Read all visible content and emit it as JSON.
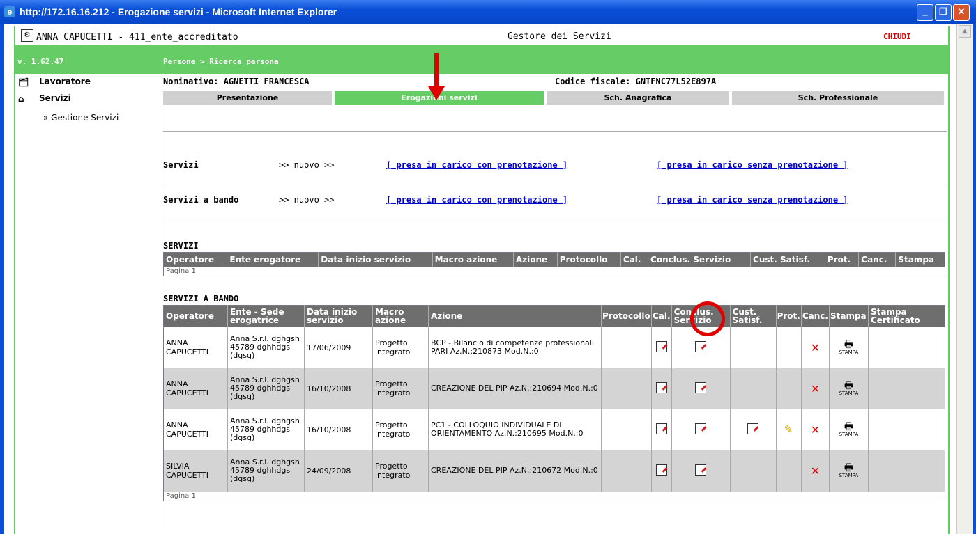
{
  "window": {
    "title": "http://172.16.16.212 - Erogazione servizi - Microsoft Internet Explorer",
    "buttons": {
      "minimize": "_",
      "maximize": "❐",
      "close": "✕"
    }
  },
  "header": {
    "user": "ANNA CAPUCETTI - 411_ente_accreditato",
    "app_title": "Gestore dei Servizi",
    "close_label": "CHIUDI",
    "version": "v. 1.62.47",
    "breadcrumb": "Persone > Ricerca persona"
  },
  "sidebar": {
    "items": [
      {
        "label": "Lavoratore",
        "icon": "worker-icon"
      },
      {
        "label": "Servizi",
        "icon": "home-icon"
      }
    ],
    "sub_item": "» Gestione Servizi"
  },
  "person": {
    "nominativo": "Nominativo: AGNETTI FRANCESCA",
    "codice_fiscale": "Codice fiscale: GNTFNC77L52E897A"
  },
  "tabs": [
    "Presentazione",
    "Erogazioni servizi",
    "Sch. Anagrafica",
    "Sch. Professionale"
  ],
  "active_tab": "Erogazioni servizi",
  "services_rows": [
    {
      "label": "Servizi",
      "nuovo": ">> nuovo >>",
      "link1": "[ presa in carico con prenotazione ]",
      "link2": "[ presa in carico senza prenotazione ]"
    },
    {
      "label": "Servizi a bando",
      "nuovo": ">> nuovo >>",
      "link1": "[ presa in carico con prenotazione ]",
      "link2": "[ presa in carico senza prenotazione ]"
    }
  ],
  "servizi_table": {
    "title": "SERVIZI",
    "columns": [
      "Operatore",
      "Ente erogatore",
      "Data inizio servizio",
      "Macro azione",
      "Azione",
      "Protocollo",
      "Cal.",
      "Conclus. Servizio",
      "Cust. Satisf.",
      "Prot.",
      "Canc.",
      "Stampa"
    ],
    "pager": "Pagina 1"
  },
  "bando_table": {
    "title": "SERVIZI A BANDO",
    "columns": [
      "Operatore",
      "Ente - Sede erogatrice",
      "Data inizio servizio",
      "Macro azione",
      "Azione",
      "Protocollo",
      "Cal.",
      "Conclus. Servizio",
      "Cust. Satisf.",
      "Prot.",
      "Canc.",
      "Stampa",
      "Stampa Certificato"
    ],
    "rows": [
      {
        "operatore": "ANNA CAPUCETTI",
        "ente": "Anna S.r.l. dghgsh 45789 dghhdgs (dgsg)",
        "data": "17/06/2009",
        "macro": "Progetto integrato",
        "azione": "BCP - Bilancio di competenze professionali PARI Az.N.:210873 Mod.N.:0",
        "cust": false,
        "prot": false
      },
      {
        "operatore": "ANNA CAPUCETTI",
        "ente": "Anna S.r.l. dghgsh 45789 dghhdgs (dgsg)",
        "data": "16/10/2008",
        "macro": "Progetto integrato",
        "azione": "CREAZIONE DEL PIP Az.N.:210694 Mod.N.:0",
        "cust": false,
        "prot": false
      },
      {
        "operatore": "ANNA CAPUCETTI",
        "ente": "Anna S.r.l. dghgsh 45789 dghhdgs (dgsg)",
        "data": "16/10/2008",
        "macro": "Progetto integrato",
        "azione": "PC1 - COLLOQUIO INDIVIDUALE DI ORIENTAMENTO Az.N.:210695 Mod.N.:0",
        "cust": true,
        "prot": true
      },
      {
        "operatore": "SILVIA CAPUCETTI",
        "ente": "Anna S.r.l. dghgsh 45789 dghhdgs (dgsg)",
        "data": "24/09/2008",
        "macro": "Progetto integrato",
        "azione": "CREAZIONE DEL PIP Az.N.:210672 Mod.N.:0",
        "cust": false,
        "prot": false
      }
    ],
    "stampa_label": "STAMPA",
    "pager": "Pagina 1"
  },
  "colors": {
    "green": "#66cc66",
    "header_gray": "#6e6e6e",
    "red": "#e00000",
    "link": "#0000cc"
  }
}
